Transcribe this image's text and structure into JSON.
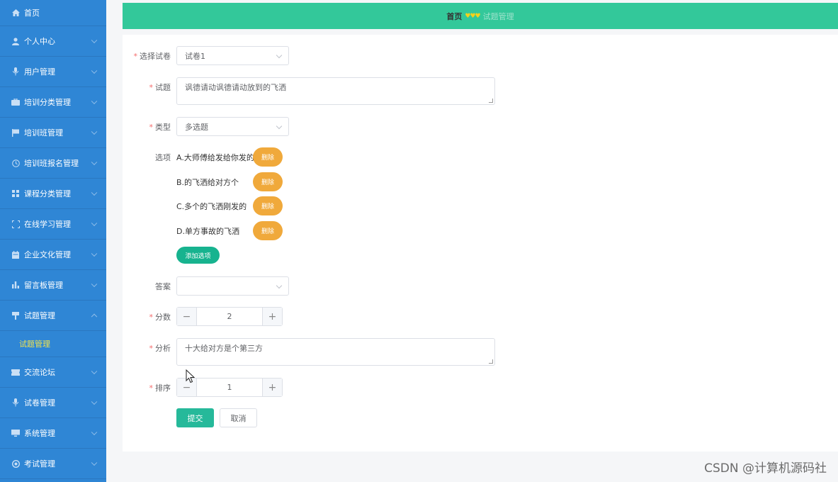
{
  "sidebar": {
    "items": [
      {
        "label": "首页",
        "icon": "home-icon"
      },
      {
        "label": "个人中心",
        "icon": "user-icon"
      },
      {
        "label": "用户管理",
        "icon": "mic-icon"
      },
      {
        "label": "培训分类管理",
        "icon": "briefcase-icon"
      },
      {
        "label": "培训班管理",
        "icon": "flag-icon"
      },
      {
        "label": "培训班报名管理",
        "icon": "clock-icon"
      },
      {
        "label": "课程分类管理",
        "icon": "grid-icon"
      },
      {
        "label": "在线学习管理",
        "icon": "frame-icon"
      },
      {
        "label": "企业文化管理",
        "icon": "calendar-icon"
      },
      {
        "label": "留言板管理",
        "icon": "bar-chart-icon"
      },
      {
        "label": "试题管理",
        "icon": "pin-icon"
      },
      {
        "label": "交流论坛",
        "icon": "ticket-icon"
      },
      {
        "label": "试卷管理",
        "icon": "mic-icon"
      },
      {
        "label": "系统管理",
        "icon": "monitor-icon"
      },
      {
        "label": "考试管理",
        "icon": "settings-icon"
      }
    ],
    "sub_item": "试题管理"
  },
  "header": {
    "home": "首页",
    "separator": "♥♥♥",
    "current": "试题管理"
  },
  "form": {
    "paper": {
      "label": "选择试卷",
      "value": "试卷1"
    },
    "question": {
      "label": "试题",
      "value": "讽德请动讽德请动放到的飞洒"
    },
    "type": {
      "label": "类型",
      "value": "多选题"
    },
    "options": {
      "label": "选项",
      "items": [
        "A.大师傅给发给你发的",
        "B.的飞洒给对方个",
        "C.多个的飞洒刚发的",
        "D.单方事故的飞洒"
      ],
      "delete_label": "删除",
      "add_label": "添加选项"
    },
    "answer": {
      "label": "答案",
      "value": ""
    },
    "score": {
      "label": "分数",
      "value": "2"
    },
    "analysis": {
      "label": "分析",
      "value": "十大给对方是个第三方"
    },
    "order": {
      "label": "排序",
      "value": "1"
    },
    "submit_label": "提交",
    "cancel_label": "取消"
  },
  "watermark": "CSDN @计算机源码社",
  "colors": {
    "sidebar": "#2f86d5",
    "header": "#33c89a",
    "active_sub": "#f2e34d",
    "delete_btn": "#f0a93b",
    "add_btn": "#17b38f",
    "submit_btn": "#26b99a"
  }
}
